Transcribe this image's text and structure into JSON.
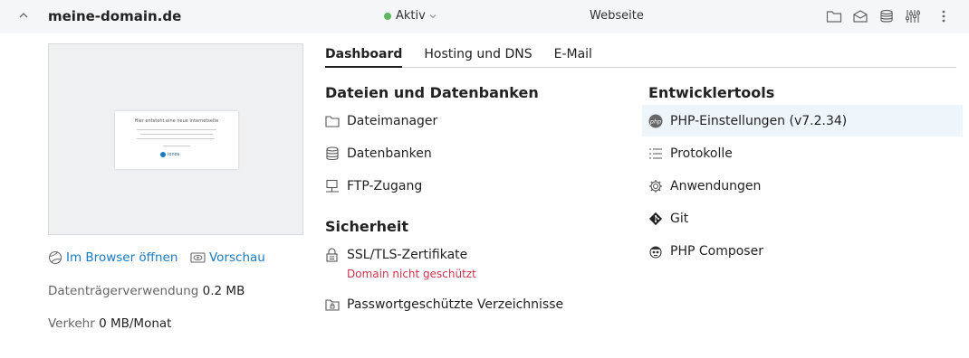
{
  "header": {
    "domain": "meine-domain.de",
    "status": "Aktiv",
    "status_color": "#5cb85c",
    "site_type": "Webseite",
    "icons": [
      "folder-icon",
      "mail-icon",
      "database-icon",
      "sliders-icon",
      "more-vertical-icon"
    ]
  },
  "preview": {
    "thumbnail_title": "Hier entsteht eine neue Internetseite",
    "thumbnail_logo": "ionos"
  },
  "links": {
    "browser": "Im Browser öffnen",
    "preview": "Vorschau"
  },
  "stats": {
    "disk_label": "Datenträgerverwendung",
    "disk_value": "0.2 MB",
    "traffic_label": "Verkehr",
    "traffic_value": "0 MB/Monat"
  },
  "tabs": [
    {
      "label": "Dashboard",
      "active": true
    },
    {
      "label": "Hosting und DNS",
      "active": false
    },
    {
      "label": "E-Mail",
      "active": false
    }
  ],
  "files_section": {
    "title": "Dateien und Datenbanken",
    "items": [
      {
        "label": "Dateimanager",
        "icon": "folder-icon"
      },
      {
        "label": "Datenbanken",
        "icon": "database-icon"
      },
      {
        "label": "FTP-Zugang",
        "icon": "ftp-icon"
      }
    ]
  },
  "security_section": {
    "title": "Sicherheit",
    "items": [
      {
        "label": "SSL/TLS-Zertifikate",
        "icon": "ssl-lock-icon",
        "warning": "Domain nicht geschützt"
      },
      {
        "label": "Passwortgeschützte Verzeichnisse",
        "icon": "protected-folder-icon"
      }
    ]
  },
  "dev_section": {
    "title": "Entwicklertools",
    "items": [
      {
        "label": "PHP-Einstellungen (v7.2.34)",
        "icon": "php-icon"
      },
      {
        "label": "Protokolle",
        "icon": "list-icon"
      },
      {
        "label": "Anwendungen",
        "icon": "gear-icon"
      },
      {
        "label": "Git",
        "icon": "git-icon"
      },
      {
        "label": "PHP Composer",
        "icon": "composer-icon"
      }
    ]
  },
  "colors": {
    "link": "#1a7ac2",
    "warning": "#d0344a",
    "highlight": "#eef5fb"
  }
}
